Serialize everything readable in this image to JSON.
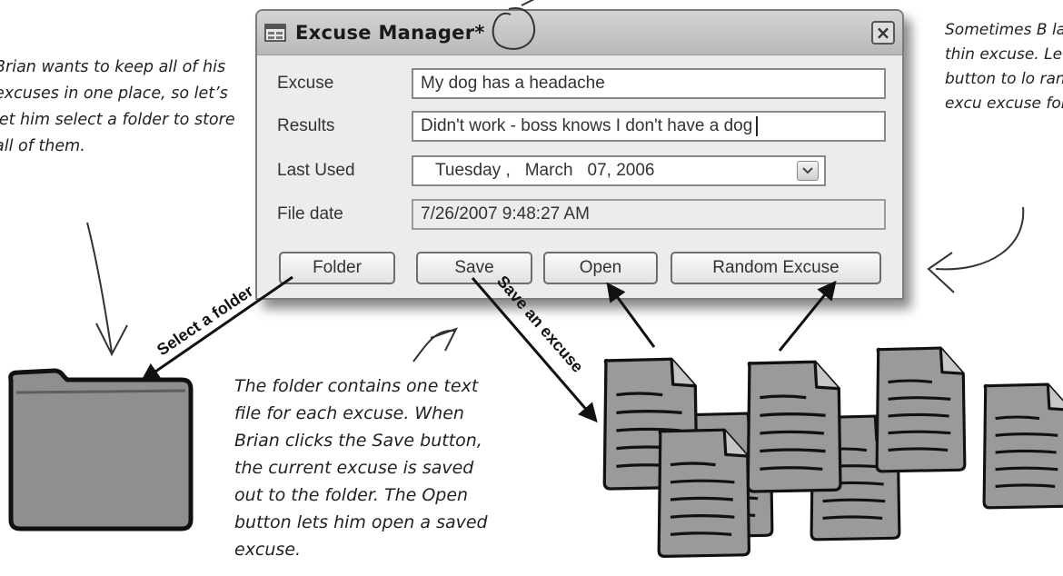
{
  "window": {
    "title": "Excuse Manager*",
    "close_glyph": "×",
    "icon": "form-icon"
  },
  "form": {
    "excuse_label": "Excuse",
    "excuse_value": "My dog has a headache",
    "results_label": "Results",
    "results_value": "Didn't work - boss knows I don't have a dog",
    "last_used_label": "Last Used",
    "last_used_day": "Tuesday  ,",
    "last_used_month": "March",
    "last_used_date": "07, 2006",
    "file_date_label": "File date",
    "file_date_value": "7/26/2007 9:48:27 AM"
  },
  "buttons": {
    "folder": "Folder",
    "save": "Save",
    "open": "Open",
    "random": "Random Excuse"
  },
  "arrows": {
    "select_folder": "Select a folder",
    "save_excuse": "Save an excuse"
  },
  "notes": {
    "left": "Brian wants to keep all of his excuses in one place, so let’s let him select a folder to store all of them.",
    "right": "Sometimes B lazy to thin excuse. Let’ button to lo random excu excuse folde",
    "bottom": "The folder contains one text file for each excuse. When Brian clicks the Save button, the current excuse is saved out to the folder. The Open button lets him open a saved excuse."
  },
  "colors": {
    "folder_fill": "#8f8f8f",
    "document_fill": "#9a9a9a",
    "ink": "#111111"
  }
}
